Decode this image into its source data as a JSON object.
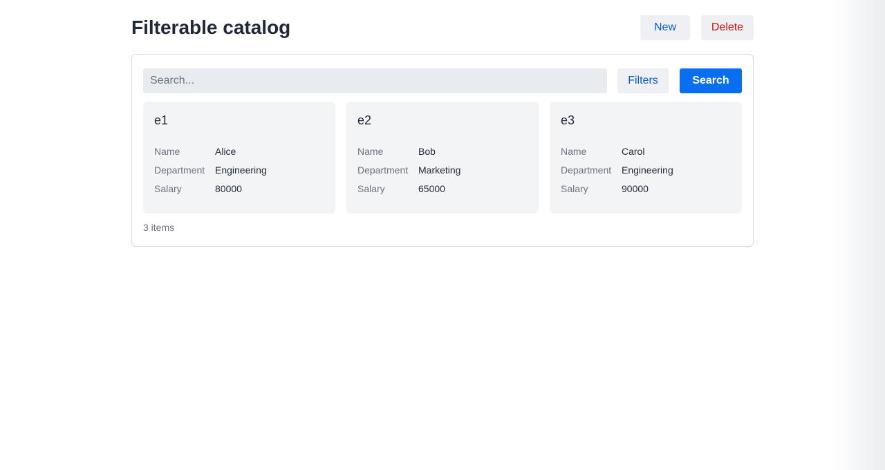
{
  "header": {
    "title": "Filterable catalog",
    "new_label": "New",
    "delete_label": "Delete"
  },
  "toolbar": {
    "search_placeholder": "Search...",
    "search_value": "",
    "filters_label": "Filters",
    "search_label": "Search"
  },
  "cards": [
    {
      "title": "e1",
      "fields": [
        {
          "label": "Name",
          "value": "Alice"
        },
        {
          "label": "Department",
          "value": "Engineering"
        },
        {
          "label": "Salary",
          "value": "80000"
        }
      ]
    },
    {
      "title": "e2",
      "fields": [
        {
          "label": "Name",
          "value": "Bob"
        },
        {
          "label": "Department",
          "value": "Marketing"
        },
        {
          "label": "Salary",
          "value": "65000"
        }
      ]
    },
    {
      "title": "e3",
      "fields": [
        {
          "label": "Name",
          "value": "Carol"
        },
        {
          "label": "Department",
          "value": "Engineering"
        },
        {
          "label": "Salary",
          "value": "90000"
        }
      ]
    }
  ],
  "footer": {
    "count_label": "3 items"
  },
  "colors": {
    "primary": "#0a6ef0",
    "link": "#0a5ccc",
    "danger": "#d00f0f",
    "card_bg": "#f3f4f6"
  }
}
